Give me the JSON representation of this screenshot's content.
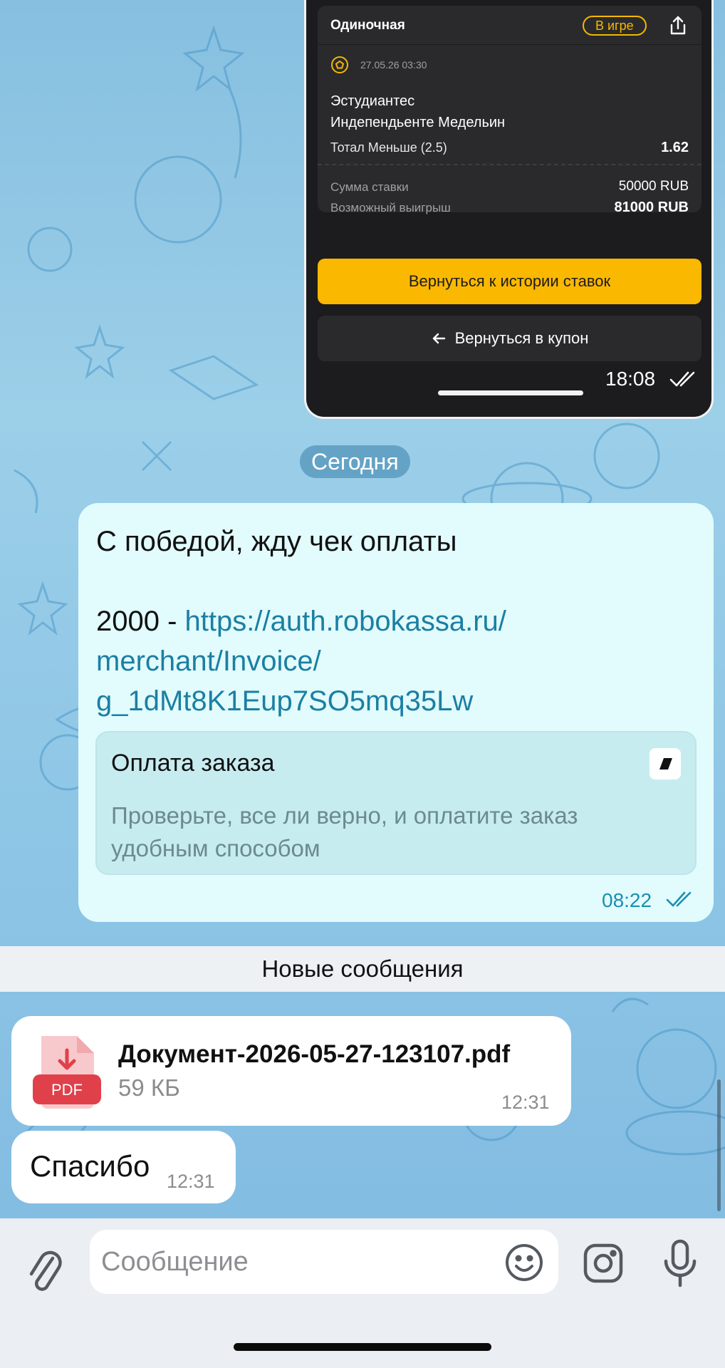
{
  "bet_screenshot": {
    "bet_type": "Одиночная",
    "status": "В игре",
    "datetime": "27.05.26 03:30",
    "team1": "Эстудиантес",
    "team2": "Индепендьенте Медельин",
    "market": "Тотал Меньше (2.5)",
    "odds": "1.62",
    "stake_label": "Сумма ставки",
    "stake_value": "50000 RUB",
    "win_label": "Возможный выигрыш",
    "win_value": "81000 RUB",
    "history_button": "Вернуться к истории ставок",
    "coupon_button": "Вернуться в купон",
    "time": "18:08"
  },
  "date_chip": "Сегодня",
  "outgoing_message": {
    "line1": "С победой, жду чек оплаты",
    "amount": "2000 - ",
    "link": "https://auth.robokassa.ru/ merchant/Invoice/ g_1dMt8K1Eup7SO5mq35Lw",
    "preview_title": "Оплата заказа",
    "preview_description": "Проверьте, все ли верно, и оплатите заказ удобным способом",
    "time": "08:22"
  },
  "new_messages_label": "Новые сообщения",
  "file_message": {
    "file_name": "Документ-2026-05-27-123107.pdf",
    "file_size": "59 КБ",
    "file_type": "PDF",
    "time": "12:31"
  },
  "incoming_message": {
    "text": "Спасибо",
    "time": "12:31"
  },
  "composer": {
    "placeholder": "Сообщение"
  },
  "colors": {
    "accent_yellow": "#fbb800",
    "outgoing_bubble": "#e2fbfd",
    "link": "#1b7fa3",
    "pdf_red": "#e0404a"
  }
}
